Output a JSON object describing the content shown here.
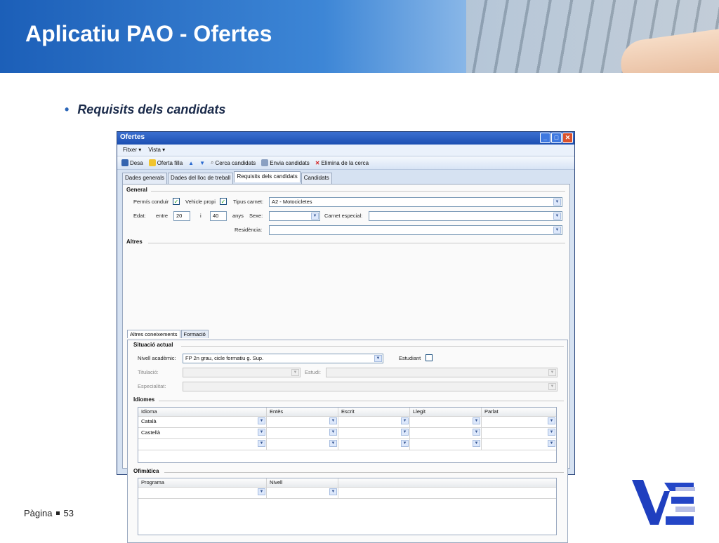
{
  "slide": {
    "title": "Aplicatiu PAO - Ofertes",
    "bullet": "Requisits dels candidats",
    "footer_label": "Pàgina",
    "page_number": "53"
  },
  "window": {
    "title": "Ofertes",
    "menu": [
      "Fitxer ▾",
      "Vista ▾"
    ],
    "toolbar": {
      "save": "Desa",
      "child_offer": "Oferta filla",
      "search_candidates": "Cerca candidats",
      "send_candidates": "Envia candidats",
      "delete_search": "Elimina de la cerca"
    },
    "tabs": [
      "Dades generals",
      "Dades del lloc de treball",
      "Requisits dels candidats",
      "Candidats"
    ],
    "active_tab": "Requisits dels candidats"
  },
  "general": {
    "section": "General",
    "driving_license_label": "Permís conduir",
    "own_vehicle_label": "Vehicle propi",
    "license_type_label": "Tipus carnet:",
    "license_type_value": "A2 - Motocicletes",
    "age_label": "Edat:",
    "between_label": "entre",
    "age_from": "20",
    "and_label": "i",
    "age_to": "40",
    "years_label": "anys",
    "sex_label": "Sexe:",
    "special_license_label": "Carnet especial:",
    "residence_label": "Residència:"
  },
  "others": {
    "section": "Altres",
    "subtabs": [
      "Altres coneixements",
      "Formació"
    ],
    "current_situation": "Situació actual",
    "academic_level_label": "Nivell acadèmic:",
    "academic_level_value": "FP 2n grau, cicle formatiu g. Sup.",
    "student_label": "Estudiant",
    "degree_label": "Titulació:",
    "study_label": "Estudi:",
    "specialty_label": "Especialitat:",
    "languages_section": "Idiomes",
    "languages_columns": [
      "Idioma",
      "Entès",
      "Escrit",
      "Llegit",
      "Parlat"
    ],
    "languages_rows": [
      "Català",
      "Castellà",
      ""
    ],
    "office_section": "Ofimàtica",
    "office_columns": [
      "Programa",
      "Nivell"
    ]
  }
}
